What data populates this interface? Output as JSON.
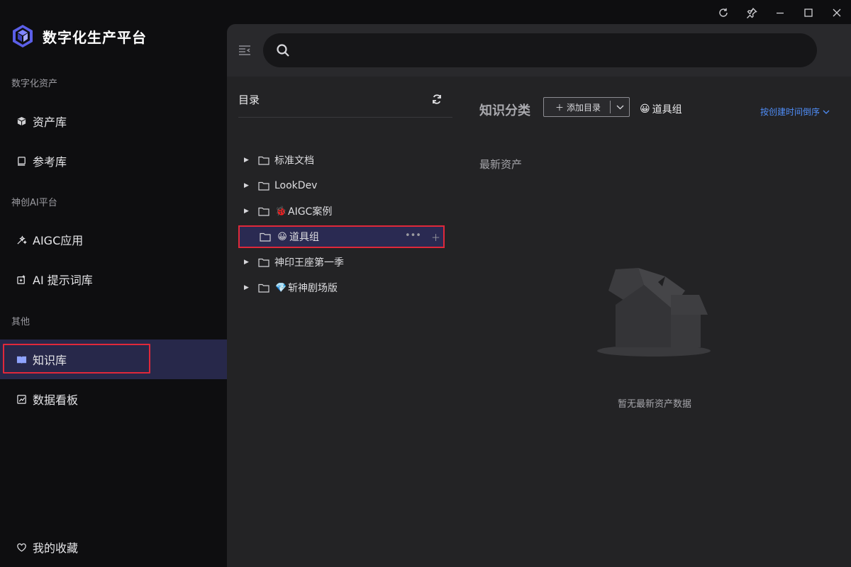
{
  "app": {
    "brand_name": "数字化生产平台"
  },
  "sidebar": {
    "sections": [
      {
        "title": "数字化资产"
      },
      {
        "title": "神创AI平台"
      },
      {
        "title": "其他"
      }
    ],
    "items": [
      {
        "label": "资产库",
        "icon": "cube-icon"
      },
      {
        "label": "参考库",
        "icon": "book-stack-icon"
      },
      {
        "label": "AIGC应用",
        "icon": "magic-wand-icon"
      },
      {
        "label": "AI 提示词库",
        "icon": "prompt-icon"
      },
      {
        "label": "知识库",
        "icon": "open-book-icon",
        "active": true
      },
      {
        "label": "数据看板",
        "icon": "chart-icon"
      }
    ],
    "favorites": {
      "label": "我的收藏",
      "icon": "heart-icon"
    }
  },
  "search": {
    "placeholder": ""
  },
  "catalog": {
    "title": "目录",
    "items": [
      {
        "label": "标准文档",
        "emoji": ""
      },
      {
        "label": "LookDev",
        "emoji": ""
      },
      {
        "label": "AIGC案例",
        "emoji": "🐞"
      },
      {
        "label": "道具组",
        "emoji": "😀",
        "selected": true
      },
      {
        "label": "神印王座第一季",
        "emoji": ""
      },
      {
        "label": "斩神剧场版",
        "emoji": "💎"
      }
    ]
  },
  "content": {
    "title": "知识分类",
    "add_button_label": "添加目录",
    "tag_emoji": "😀",
    "tag_label": "道具组",
    "sort_label": "按创建时间倒序",
    "newest_title": "最新资产",
    "empty_text": "暂无最新资产数据"
  },
  "colors": {
    "accent": "#4f8df7",
    "highlight_border": "#e0283a",
    "active_bg": "#27284a"
  }
}
